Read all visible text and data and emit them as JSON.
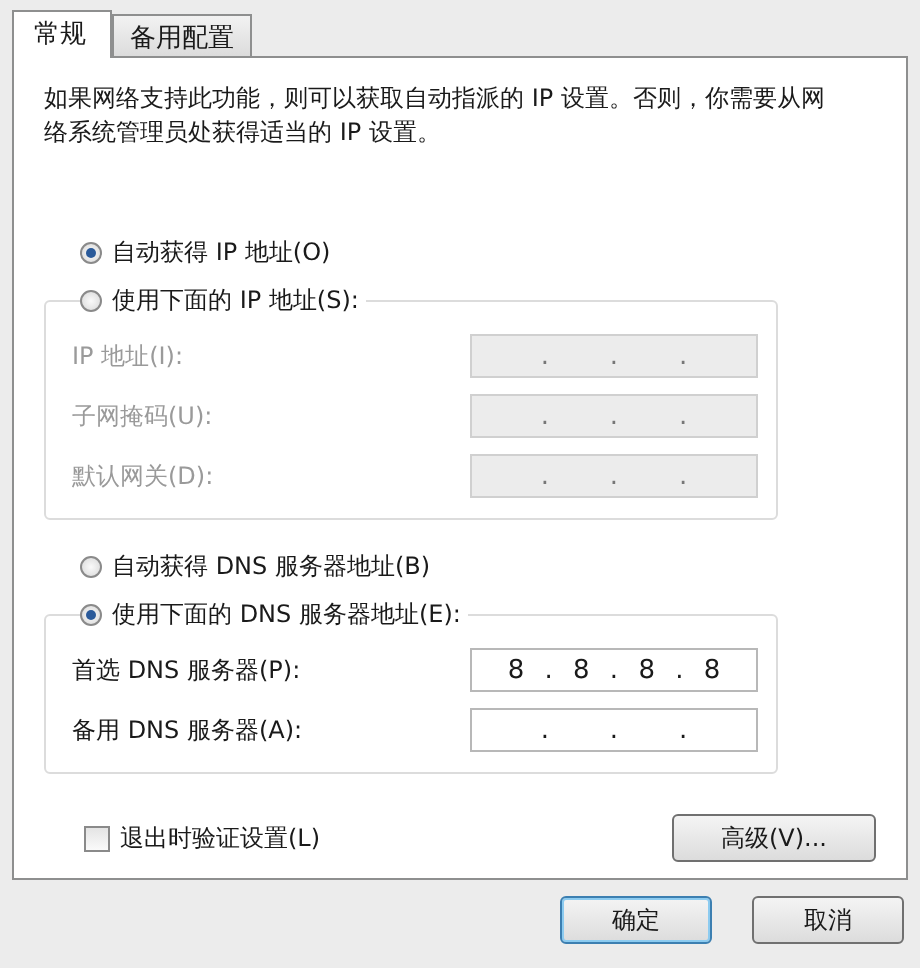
{
  "tabs": [
    {
      "label": "常规",
      "selected": true
    },
    {
      "label": "备用配置",
      "selected": false
    }
  ],
  "description": "如果网络支持此功能，则可以获取自动指派的 IP 设置。否则，你需要从网络系统管理员处获得适当的 IP 设置。",
  "ip_section": {
    "auto_option": {
      "label": "自动获得 IP 地址(O)",
      "selected": true
    },
    "manual_option": {
      "label": "使用下面的 IP 地址(S):",
      "selected": false
    },
    "disabled": true,
    "fields": [
      {
        "label": "IP 地址(I):",
        "value": ".   .   ."
      },
      {
        "label": "子网掩码(U):",
        "value": ".   .   ."
      },
      {
        "label": "默认网关(D):",
        "value": ".   .   ."
      }
    ]
  },
  "dns_section": {
    "auto_option": {
      "label": "自动获得 DNS 服务器地址(B)",
      "selected": false
    },
    "manual_option": {
      "label": "使用下面的 DNS 服务器地址(E):",
      "selected": true
    },
    "disabled": false,
    "fields": [
      {
        "label": "首选 DNS 服务器(P):",
        "value": "8 . 8 . 8 . 8"
      },
      {
        "label": "备用 DNS 服务器(A):",
        "value": ".   .   ."
      }
    ]
  },
  "validate_checkbox": {
    "label": "退出时验证设置(L)",
    "checked": false
  },
  "advanced_button": "高级(V)...",
  "buttons": [
    {
      "label": "确定",
      "default": true
    },
    {
      "label": "取消",
      "default": false
    }
  ]
}
